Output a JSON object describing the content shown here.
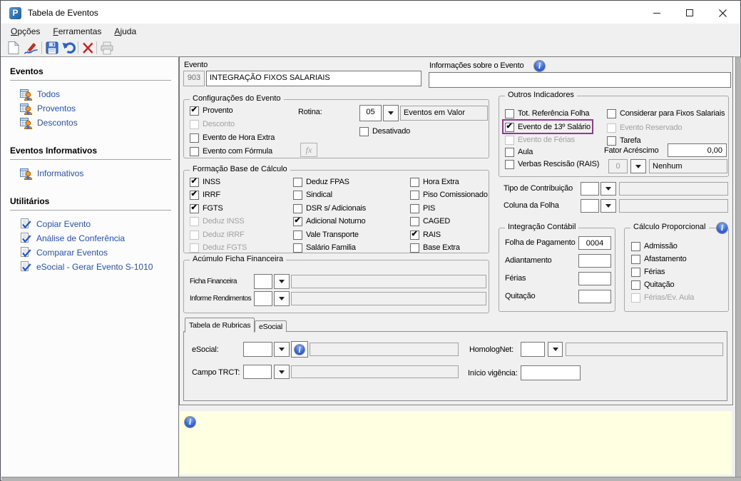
{
  "window": {
    "title": "Tabela de Eventos",
    "icon_letter": "P"
  },
  "menu": {
    "items": [
      {
        "label": "Opções"
      },
      {
        "label": "Ferramentas"
      },
      {
        "label": "Ajuda"
      }
    ]
  },
  "toolbar": {
    "icons": [
      "new-document",
      "edit-pencil",
      "save",
      "undo",
      "delete",
      "print"
    ]
  },
  "sidebar": {
    "sections": [
      {
        "title": "Eventos",
        "icon": "grid-user",
        "items": [
          "Todos",
          "Proventos",
          "Descontos"
        ]
      },
      {
        "title": "Eventos Informativos",
        "icon": "grid-user",
        "items": [
          "Informativos"
        ]
      },
      {
        "title": "Utilitários",
        "icon": "doc-check",
        "items": [
          "Copiar Evento",
          "Análise de Conferência",
          "Comparar Eventos",
          "eSocial - Gerar Evento S-1010"
        ]
      }
    ]
  },
  "evento": {
    "label": "Evento",
    "code": "903",
    "name": "INTEGRAÇÃO FIXOS SALARIAIS"
  },
  "informacoes": {
    "label": "Informações sobre o Evento",
    "value": ""
  },
  "configuracoes": {
    "title": "Configurações do Evento",
    "checkboxes": [
      {
        "label": "Provento",
        "checked": true
      },
      {
        "label": "Desconto",
        "disabled": true
      },
      {
        "label": "Evento de Hora Extra"
      },
      {
        "label": "Evento com Fórmula"
      }
    ],
    "fx_button": "fx",
    "rotina_label": "Rotina:",
    "rotina_value": "05",
    "rotina_desc": "Eventos em Valor",
    "desativado": {
      "label": "Desativado"
    }
  },
  "outros": {
    "title": "Outros Indicadores",
    "col1": [
      {
        "label": "Tot. Referência Folha"
      },
      {
        "label": "Evento de 13º Salário",
        "checked": true,
        "highlight": true
      },
      {
        "label": "Evento de Férias",
        "disabled": true
      },
      {
        "label": "Aula"
      },
      {
        "label": "Verbas Rescisão (RAIS)"
      }
    ],
    "col2": [
      {
        "label": "Considerar para Fixos Salariais"
      },
      {
        "label": "Evento Reservado",
        "disabled": true
      },
      {
        "label": "Tarefa"
      }
    ],
    "fator_label": "Fator Acréscimo",
    "fator_value": "0,00",
    "verba_value": "0",
    "verba_desc": "Nenhum",
    "tipo_contribuicao_label": "Tipo de Contribuição",
    "coluna_folha_label": "Coluna da Folha"
  },
  "formacao": {
    "title": "Formação Base de Cálculo",
    "columns": [
      [
        {
          "label": "INSS",
          "checked": true
        },
        {
          "label": "IRRF",
          "checked": true
        },
        {
          "label": "FGTS",
          "checked": true
        },
        {
          "label": "Deduz INSS",
          "disabled": true
        },
        {
          "label": "Deduz IRRF",
          "disabled": true
        },
        {
          "label": "Deduz FGTS",
          "disabled": true
        }
      ],
      [
        {
          "label": "Deduz FPAS"
        },
        {
          "label": "Sindical"
        },
        {
          "label": "DSR s/ Adicionais"
        },
        {
          "label": "Adicional Noturno",
          "checked": true
        },
        {
          "label": "Vale Transporte"
        },
        {
          "label": "Salário Familia"
        }
      ],
      [
        {
          "label": "Hora Extra"
        },
        {
          "label": "Piso Comissionado"
        },
        {
          "label": "PIS"
        },
        {
          "label": "CAGED"
        },
        {
          "label": "RAIS",
          "checked": true
        },
        {
          "label": "Base Extra"
        }
      ]
    ]
  },
  "acumulo": {
    "title": "Acúmulo Ficha Financeira",
    "rows": [
      {
        "label": "Ficha Financeira"
      },
      {
        "label": "Informe Rendimentos"
      }
    ]
  },
  "integracao": {
    "title": "Integração Contábil",
    "rows": [
      {
        "label": "Folha de Pagamento",
        "value": "0004"
      },
      {
        "label": "Adiantamento",
        "value": ""
      },
      {
        "label": "Férias",
        "value": ""
      },
      {
        "label": "Quitação",
        "value": ""
      }
    ]
  },
  "calculo": {
    "title": "Cálculo Proporcional",
    "checkboxes": [
      {
        "label": "Admissão"
      },
      {
        "label": "Afastamento"
      },
      {
        "label": "Férias"
      },
      {
        "label": "Quitação"
      },
      {
        "label": "Férias/Ev. Aula",
        "disabled": true
      }
    ]
  },
  "tabs": {
    "items": [
      {
        "label": "Tabela de Rubricas",
        "active": true
      },
      {
        "label": "eSocial"
      }
    ]
  },
  "rubricas": {
    "esocial_label": "eSocial:",
    "homolognet_label": "HomologNet:",
    "campo_trct_label": "Campo TRCT:",
    "inicio_vigencia_label": "Início vigência:"
  }
}
